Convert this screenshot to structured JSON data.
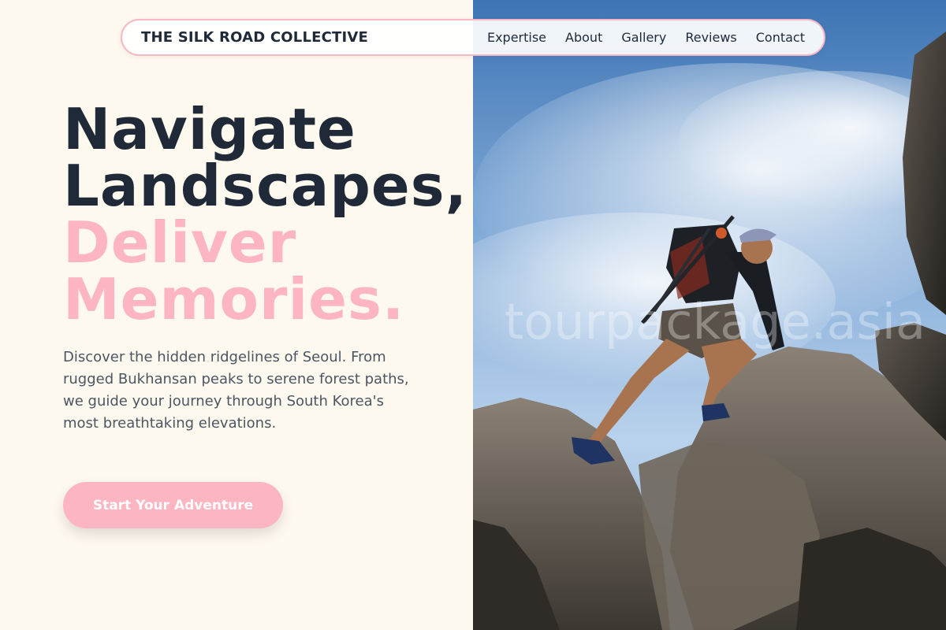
{
  "nav": {
    "brand": "THE SILK ROAD COLLECTIVE",
    "links": [
      "Expertise",
      "About",
      "Gallery",
      "Reviews",
      "Contact"
    ]
  },
  "hero": {
    "headline_lines": [
      "Navigate",
      "Landscapes,"
    ],
    "accent_lines": [
      "Deliver",
      "Memories."
    ],
    "description": "Discover the hidden ridgelines of Seoul. From rugged Bukhansan peaks to serene forest paths, we guide your journey through South Korea's most breathtaking elevations.",
    "cta_label": "Start Your Adventure"
  },
  "image": {
    "watermark": "tourpackage.asia",
    "alt": "Hiker climbing rocky mountain ridge under blue sky"
  },
  "colors": {
    "background": "#fef9ee",
    "text_dark": "#1f2937",
    "text_muted": "#4b5563",
    "accent_pink": "#fdb6c1",
    "nav_border": "#f7b7c3"
  }
}
